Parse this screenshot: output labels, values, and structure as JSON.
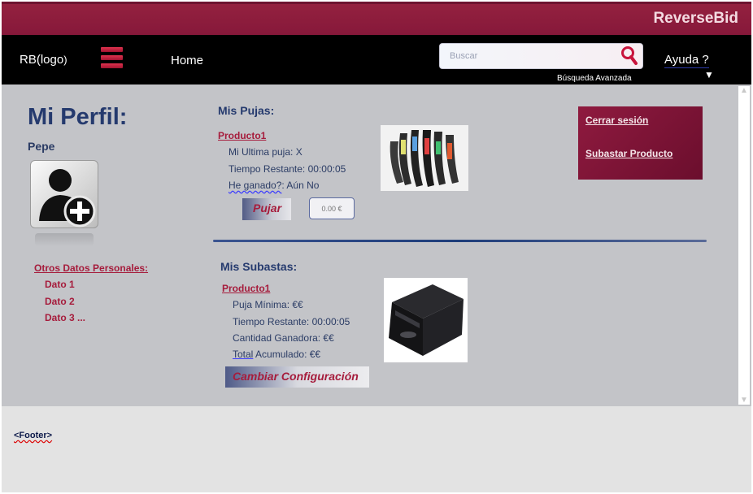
{
  "brand": "ReverseBid",
  "nav": {
    "logo": "RB(logo",
    "logo_suffix": ")",
    "home": "Home",
    "search_placeholder": "Buscar",
    "advanced_search": "Búsqueda  Avanzada",
    "help": "Ayuda ?"
  },
  "profile": {
    "title": "Mi Perfil:",
    "username": "Pepe",
    "other_data_title": "Otros Datos Personales:",
    "other_data": [
      "Dato 1",
      "Dato 2",
      "Dato 3 ..."
    ]
  },
  "bids": {
    "title": "Mis Pujas:",
    "product": "Producto1",
    "last_bid": "Mi Ultima puja: X",
    "time_left": "Tiempo Restante: 00:00:05",
    "won_label": "He ganado?",
    "won_value": ": Aún No",
    "bid_button": "Pujar",
    "bid_input_placeholder": "0.00 €"
  },
  "auctions": {
    "title": "Mis Subastas:",
    "product": "Producto1",
    "min_bid": "Puja Mínima: €€",
    "time_left": "Tiempo Restante: 00:00:05",
    "winning_amount": "Cantidad Ganadora: €€",
    "total_label": "Total",
    "total_value": " Acumulado: €€",
    "config_button": "Cambiar Configuración"
  },
  "side_menu": {
    "logout": "Cerrar sesión",
    "auction_product": "Subastar Producto"
  },
  "footer": "<Footer>",
  "colors": {
    "brand_bar": "#8b1c3d",
    "accent": "#a61c3c",
    "navy": "#253a6e",
    "main_bg": "#c3c4c8"
  }
}
